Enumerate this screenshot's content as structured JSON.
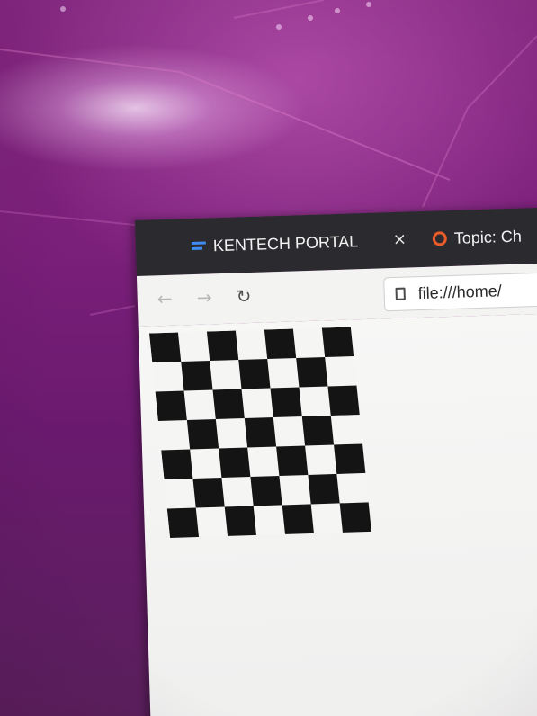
{
  "browser": {
    "tabs": [
      {
        "label": "KENTECH PORTAL",
        "icon": "portal-icon",
        "active": true
      },
      {
        "label": "Topic: Ch",
        "icon": "topic-icon",
        "active": false
      }
    ],
    "close_glyph": "×",
    "nav": {
      "back_glyph": "←",
      "forward_glyph": "→",
      "reload_glyph": "↻"
    },
    "url": "file:///home/"
  },
  "page": {
    "checkerboard": {
      "rows": 7,
      "cols": 7,
      "dark_color": "#141414",
      "light_color": "#f5f5f4"
    }
  },
  "colors": {
    "desktop_purple": "#7a1f7a",
    "tabbar": "#2b2a2e",
    "toolbar": "#f3f3f2",
    "portal_icon_blue": "#3f8df2",
    "topic_icon_orange": "#ea5b2a"
  }
}
